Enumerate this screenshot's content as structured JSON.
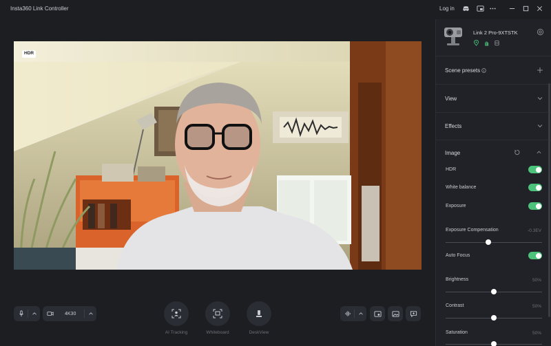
{
  "app": {
    "title": "Insta360 Link Controller",
    "login_label": "Log in",
    "icons": [
      "discord-icon",
      "picture-in-picture-icon",
      "more-icon",
      "minimize-icon",
      "maximize-icon",
      "close-icon"
    ]
  },
  "preview": {
    "badge": "HDR"
  },
  "toolbar": {
    "resolution": "4K30",
    "ai_tracking_label": "AI Tracking",
    "whiteboard_label": "Whiteboard",
    "deskview_label": "DeskView"
  },
  "device": {
    "name": "Link 2 Pro-9XTSTK"
  },
  "panel": {
    "scene_presets": "Scene presets",
    "view": "View",
    "effects": "Effects",
    "image": "Image",
    "hdr": {
      "label": "HDR",
      "on": true
    },
    "white_balance": {
      "label": "White balance",
      "on": true
    },
    "exposure": {
      "label": "Exposure",
      "on": true
    },
    "exposure_compensation": {
      "label": "Exposure Compensation",
      "value": "-0.3EV",
      "level": 0.44
    },
    "auto_focus": {
      "label": "Auto Focus",
      "on": true
    },
    "brightness": {
      "label": "Brightness",
      "value": "50%",
      "level": 0.5
    },
    "contrast": {
      "label": "Contrast",
      "value": "50%",
      "level": 0.5
    },
    "saturation": {
      "label": "Saturation",
      "value": "50%",
      "level": 0.5
    }
  },
  "colors": {
    "background": "#1c1e22",
    "panel": "#202227",
    "toggle_on": "#4cc27a",
    "device_status_green": "#4cc27a"
  }
}
